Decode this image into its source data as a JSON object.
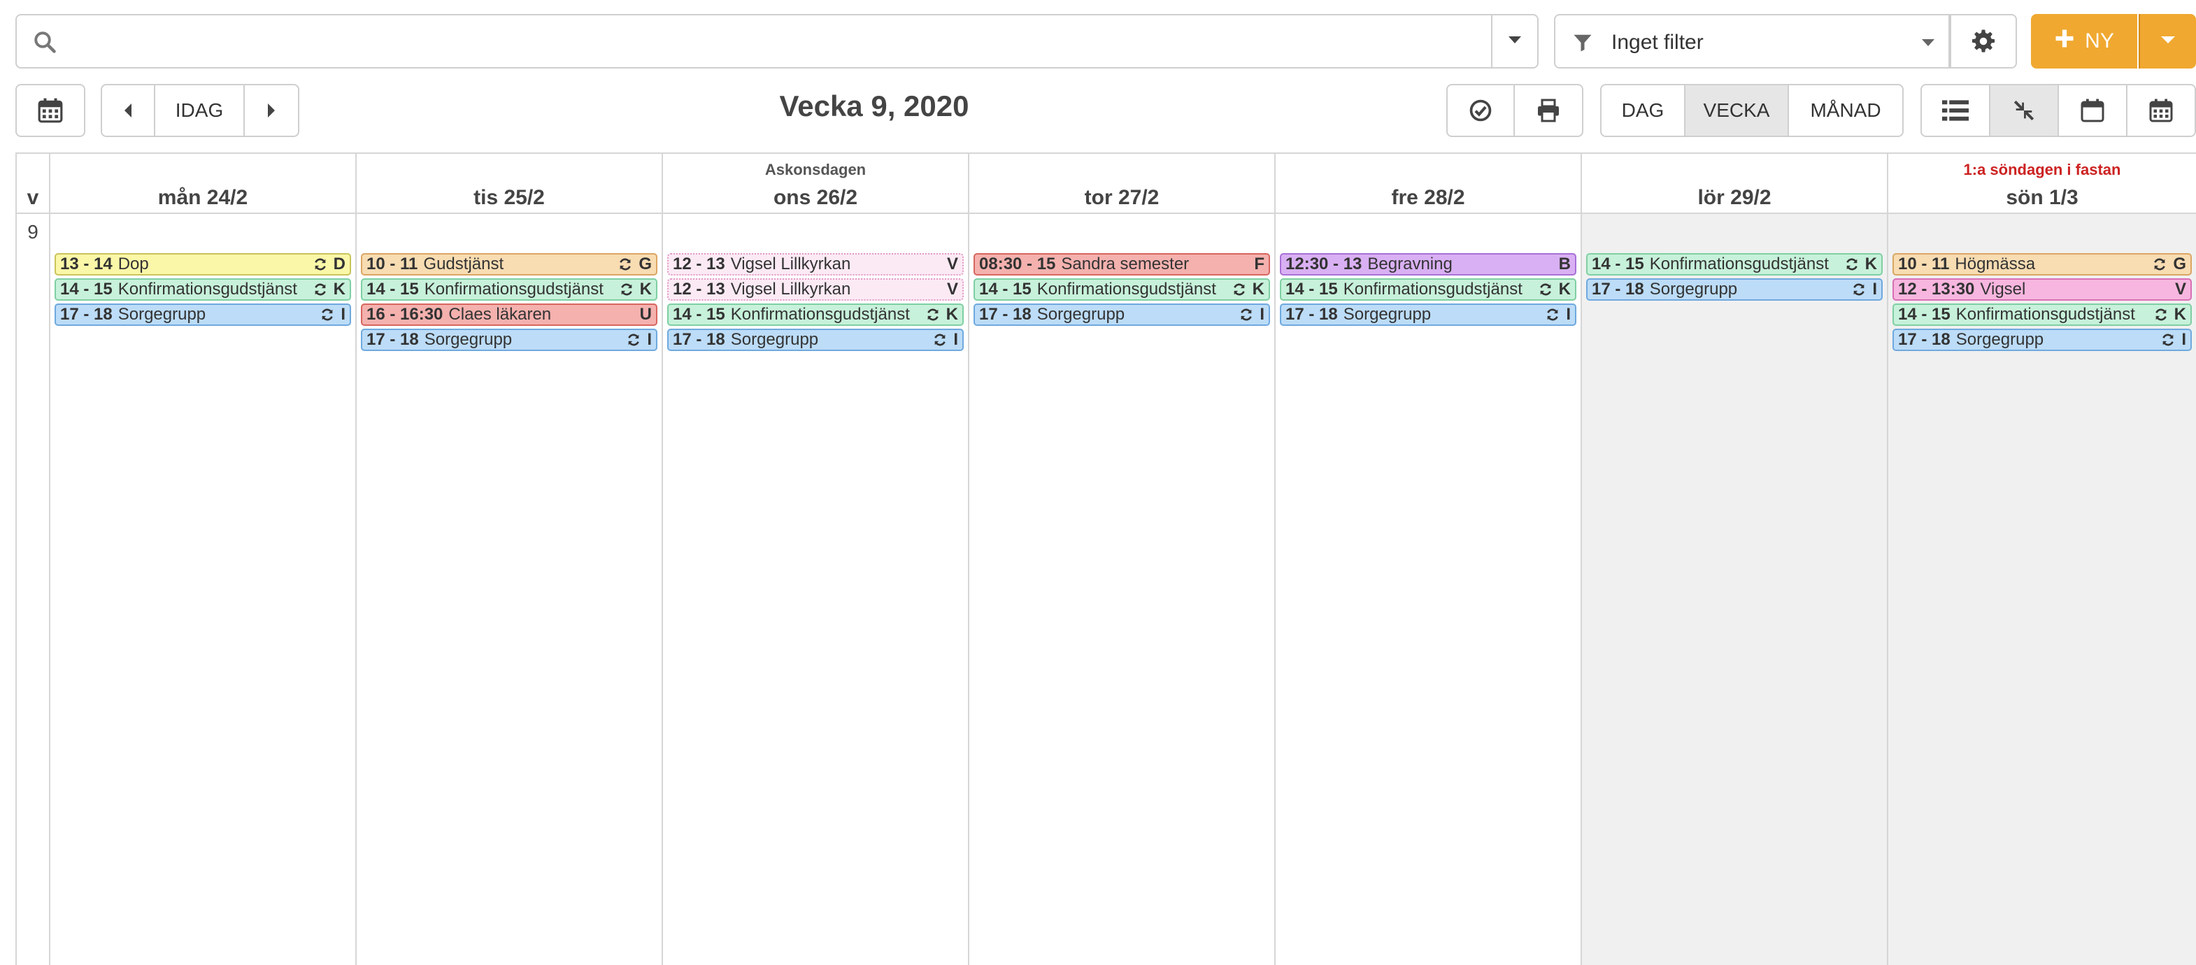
{
  "search": {
    "placeholder": ""
  },
  "filter": {
    "label": "Inget filter"
  },
  "new_button": {
    "label": "NY"
  },
  "nav": {
    "today_label": "IDAG"
  },
  "week_title": "Vecka 9, 2020",
  "views": {
    "day": "DAG",
    "week": "VECKA",
    "month": "MÅNAD",
    "active": "week"
  },
  "colors": {
    "accent": "#f0a830",
    "yellow": "#fbf7a8",
    "orange": "#f8dcb2",
    "green": "#c7f1da",
    "blue": "#bcdcf7",
    "red": "#f4b1ae",
    "purple": "#d9b0f3",
    "pink": "#f7b6df",
    "lightpink": "#fbeaf4"
  },
  "calendar": {
    "week_header": "v",
    "week_number": "9",
    "days": [
      {
        "label": "mån 24/2",
        "holiday": "",
        "holiday_red": false,
        "weekend": false,
        "events": [
          {
            "time": "13 - 14",
            "title": "Dop",
            "code": "D",
            "repeat": true,
            "color": "yellow"
          },
          {
            "time": "14 - 15",
            "title": "Konfirmationsgudstjänst",
            "code": "K",
            "repeat": true,
            "color": "green"
          },
          {
            "time": "17 - 18",
            "title": "Sorgegrupp",
            "code": "I",
            "repeat": true,
            "color": "blue"
          }
        ]
      },
      {
        "label": "tis 25/2",
        "holiday": "",
        "holiday_red": false,
        "weekend": false,
        "events": [
          {
            "time": "10 - 11",
            "title": "Gudstjänst",
            "code": "G",
            "repeat": true,
            "color": "orange"
          },
          {
            "time": "14 - 15",
            "title": "Konfirmationsgudstjänst",
            "code": "K",
            "repeat": true,
            "color": "green"
          },
          {
            "time": "16 - 16:30",
            "title": "Claes läkaren",
            "code": "U",
            "repeat": false,
            "color": "red"
          },
          {
            "time": "17 - 18",
            "title": "Sorgegrupp",
            "code": "I",
            "repeat": true,
            "color": "blue"
          }
        ]
      },
      {
        "label": "ons 26/2",
        "holiday": "Askonsdagen",
        "holiday_red": false,
        "weekend": false,
        "events": [
          {
            "time": "12 - 13",
            "title": "Vigsel Lillkyrkan",
            "code": "V",
            "repeat": false,
            "color": "lightpink"
          },
          {
            "time": "12 - 13",
            "title": "Vigsel Lillkyrkan",
            "code": "V",
            "repeat": false,
            "color": "lightpink"
          },
          {
            "time": "14 - 15",
            "title": "Konfirmationsgudstjänst",
            "code": "K",
            "repeat": true,
            "color": "green"
          },
          {
            "time": "17 - 18",
            "title": "Sorgegrupp",
            "code": "I",
            "repeat": true,
            "color": "blue"
          }
        ]
      },
      {
        "label": "tor 27/2",
        "holiday": "",
        "holiday_red": false,
        "weekend": false,
        "events": [
          {
            "time": "08:30 - 15",
            "title": "Sandra semester",
            "code": "F",
            "repeat": false,
            "color": "red"
          },
          {
            "time": "14 - 15",
            "title": "Konfirmationsgudstjänst",
            "code": "K",
            "repeat": true,
            "color": "green"
          },
          {
            "time": "17 - 18",
            "title": "Sorgegrupp",
            "code": "I",
            "repeat": true,
            "color": "blue"
          }
        ]
      },
      {
        "label": "fre 28/2",
        "holiday": "",
        "holiday_red": false,
        "weekend": false,
        "events": [
          {
            "time": "12:30 - 13",
            "title": "Begravning",
            "code": "B",
            "repeat": false,
            "color": "purple"
          },
          {
            "time": "14 - 15",
            "title": "Konfirmationsgudstjänst",
            "code": "K",
            "repeat": true,
            "color": "green"
          },
          {
            "time": "17 - 18",
            "title": "Sorgegrupp",
            "code": "I",
            "repeat": true,
            "color": "blue"
          }
        ]
      },
      {
        "label": "lör 29/2",
        "holiday": "",
        "holiday_red": false,
        "weekend": true,
        "events": [
          {
            "time": "14 - 15",
            "title": "Konfirmationsgudstjänst",
            "code": "K",
            "repeat": true,
            "color": "green"
          },
          {
            "time": "17 - 18",
            "title": "Sorgegrupp",
            "code": "I",
            "repeat": true,
            "color": "blue"
          }
        ]
      },
      {
        "label": "sön 1/3",
        "holiday": "1:a söndagen i fastan",
        "holiday_red": true,
        "weekend": true,
        "events": [
          {
            "time": "10 - 11",
            "title": "Högmässa",
            "code": "G",
            "repeat": true,
            "color": "orange"
          },
          {
            "time": "12 - 13:30",
            "title": "Vigsel",
            "code": "V",
            "repeat": false,
            "color": "pink"
          },
          {
            "time": "14 - 15",
            "title": "Konfirmationsgudstjänst",
            "code": "K",
            "repeat": true,
            "color": "green"
          },
          {
            "time": "17 - 18",
            "title": "Sorgegrupp",
            "code": "I",
            "repeat": true,
            "color": "blue"
          }
        ]
      }
    ]
  }
}
